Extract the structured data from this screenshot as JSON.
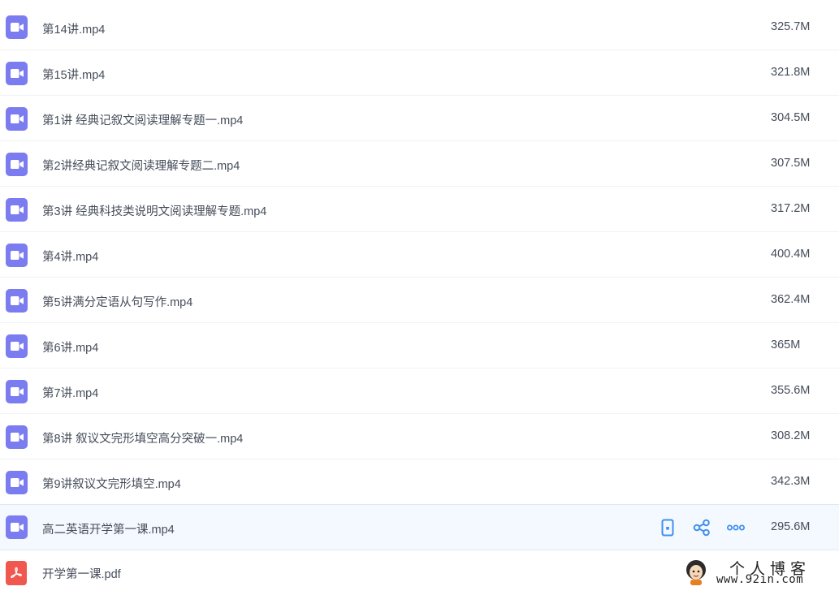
{
  "files": [
    {
      "name": "第14讲.mp4",
      "size": "325.7M",
      "type": "video"
    },
    {
      "name": "第15讲.mp4",
      "size": "321.8M",
      "type": "video"
    },
    {
      "name": "第1讲 经典记叙文阅读理解专题一.mp4",
      "size": "304.5M",
      "type": "video"
    },
    {
      "name": "第2讲经典记叙文阅读理解专题二.mp4",
      "size": "307.5M",
      "type": "video"
    },
    {
      "name": "第3讲 经典科技类说明文阅读理解专题.mp4",
      "size": "317.2M",
      "type": "video"
    },
    {
      "name": "第4讲.mp4",
      "size": "400.4M",
      "type": "video"
    },
    {
      "name": "第5讲满分定语从句写作.mp4",
      "size": "362.4M",
      "type": "video"
    },
    {
      "name": "第6讲.mp4",
      "size": "365M",
      "type": "video"
    },
    {
      "name": "第7讲.mp4",
      "size": "355.6M",
      "type": "video"
    },
    {
      "name": "第8讲 叙议文完形填空高分突破一.mp4",
      "size": "308.2M",
      "type": "video"
    },
    {
      "name": "第9讲叙议文完形填空.mp4",
      "size": "342.3M",
      "type": "video"
    },
    {
      "name": "高二英语开学第一课.mp4",
      "size": "295.6M",
      "type": "video"
    },
    {
      "name": "开学第一课.pdf",
      "size": "",
      "type": "pdf"
    }
  ],
  "row_actions": {
    "phone": "phone-icon",
    "share": "share-icon",
    "more": "more-icon"
  },
  "watermark": {
    "title": "个人博客",
    "url": "www.92in.com"
  },
  "colors": {
    "video_icon": "#7b7cf0",
    "pdf_icon": "#f0574e",
    "action_blue": "#3f8ff0",
    "hover_row": "#f4f9ff"
  }
}
